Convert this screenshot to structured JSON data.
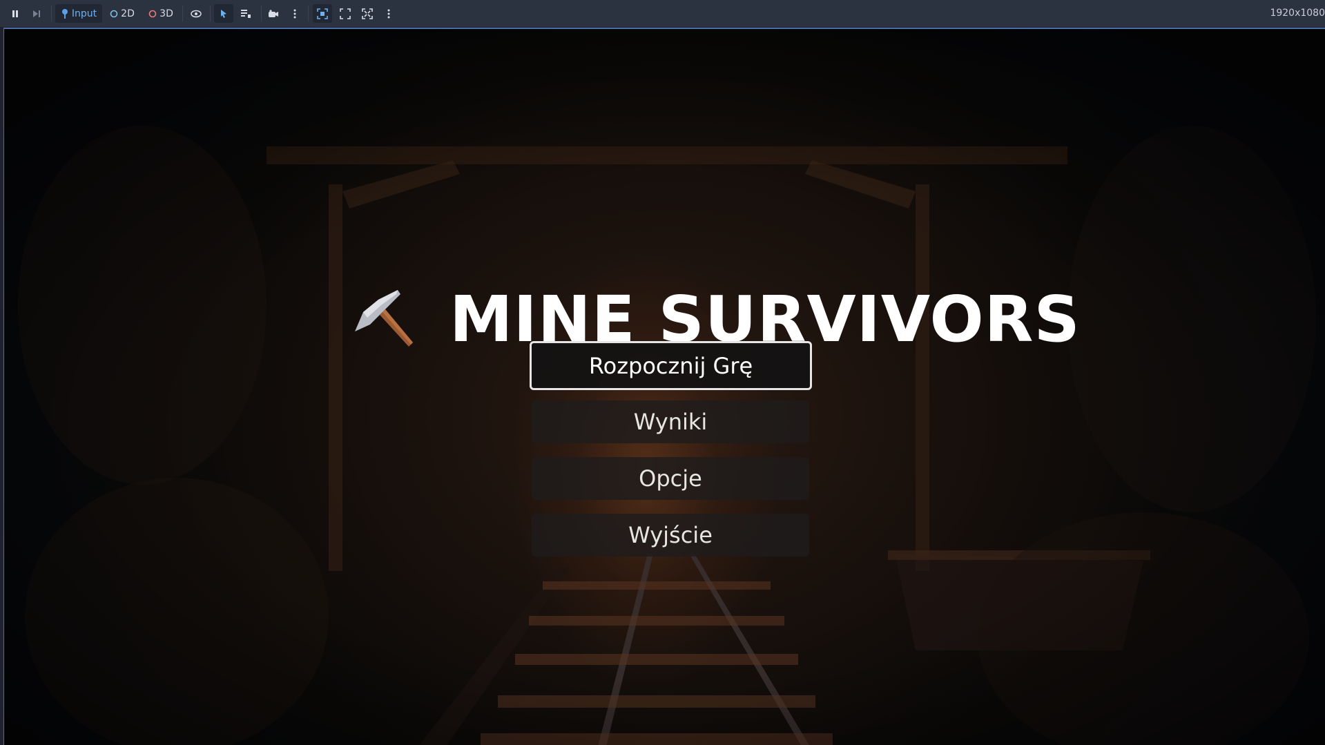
{
  "toolbar": {
    "input_label": "Input",
    "mode_2d_label": "2D",
    "mode_3d_label": "3D",
    "resolution": "1920x1080"
  },
  "game": {
    "title": "MINE SURVIVORS",
    "menu": [
      {
        "label": "Rozpocznij Grę",
        "focused": true
      },
      {
        "label": "Wyniki"
      },
      {
        "label": "Opcje"
      },
      {
        "label": "Wyjście"
      }
    ]
  },
  "colors": {
    "toolbar_bg": "#2b3240",
    "accent": "#4b6fa8",
    "title_text": "#ffffff"
  },
  "icons": [
    "pause-icon",
    "step-icon",
    "input-icon",
    "circle-2d-icon",
    "circle-3d-icon",
    "eye-icon",
    "select-arrow-icon",
    "list-icon",
    "camera-icon",
    "more-icon",
    "focus-icon",
    "expand-icon",
    "fullscreen-icon",
    "pickaxe-icon"
  ]
}
